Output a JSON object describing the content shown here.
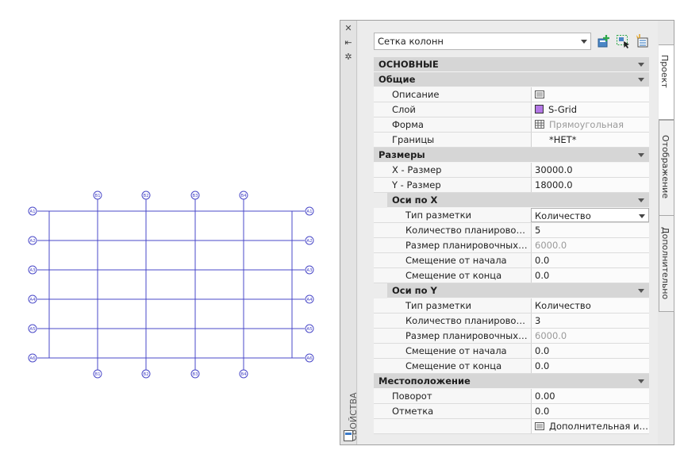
{
  "drawing": {
    "bubbles_top": [
      "B1",
      "B2",
      "B3",
      "B4"
    ],
    "bubbles_bottom": [
      "B1",
      "B2",
      "B3",
      "B4"
    ],
    "bubbles_left": [
      "A1",
      "A2",
      "A3",
      "A4",
      "A5",
      "A6"
    ],
    "bubbles_right": [
      "A1",
      "A2",
      "A3",
      "A4",
      "A5",
      "A6"
    ],
    "line_color": "#4a49c8"
  },
  "palette": {
    "side_title": "СВОЙСТВА",
    "controls": [
      "close-icon",
      "auto-hide-icon",
      "settings-icon"
    ],
    "tabs": [
      "Проект",
      "Отображение",
      "Дополнительно"
    ],
    "style_selector": "Сетка колонн",
    "toolbar_icons": [
      "add-style-icon",
      "select-similar-icon",
      "quick-select-icon"
    ]
  },
  "props": {
    "cat_main": "ОСНОВНЫЕ",
    "sec_general": "Общие",
    "description_label": "Описание",
    "layer_label": "Слой",
    "layer_value": "S-Grid",
    "layer_color": "#b478e6",
    "shape_label": "Форма",
    "shape_value": "Прямоугольная",
    "bounds_label": "Границы",
    "bounds_value": "*НЕТ*",
    "sec_sizes": "Размеры",
    "x_size_label": "X - Размер",
    "x_size_value": "30000.0",
    "y_size_label": "Y - Размер",
    "y_size_value": "18000.0",
    "sec_axes_x": "Оси по X",
    "x_layout_type_label": "Тип разметки",
    "x_layout_type_value": "Количество",
    "x_count_label": "Количество планировочных",
    "x_count_value": "5",
    "x_bay_label": "Размер планировочных элементов",
    "x_bay_value": "6000.0",
    "x_start_offset_label": "Смещение от начала",
    "x_start_offset_value": "0.0",
    "x_end_offset_label": "Смещение от конца",
    "x_end_offset_value": "0.0",
    "sec_axes_y": "Оси по Y",
    "y_layout_type_label": "Тип разметки",
    "y_layout_type_value": "Количество",
    "y_count_label": "Количество планировочных",
    "y_count_value": "3",
    "y_bay_label": "Размер планировочных элементов",
    "y_bay_value": "6000.0",
    "y_start_offset_label": "Смещение от начала",
    "y_start_offset_value": "0.0",
    "y_end_offset_label": "Смещение от конца",
    "y_end_offset_value": "0.0",
    "sec_location": "Местоположение",
    "rotation_label": "Поворот",
    "rotation_value": "0.00",
    "elevation_label": "Отметка",
    "elevation_value": "0.0",
    "extra_info_value": "Дополнительная информация"
  }
}
